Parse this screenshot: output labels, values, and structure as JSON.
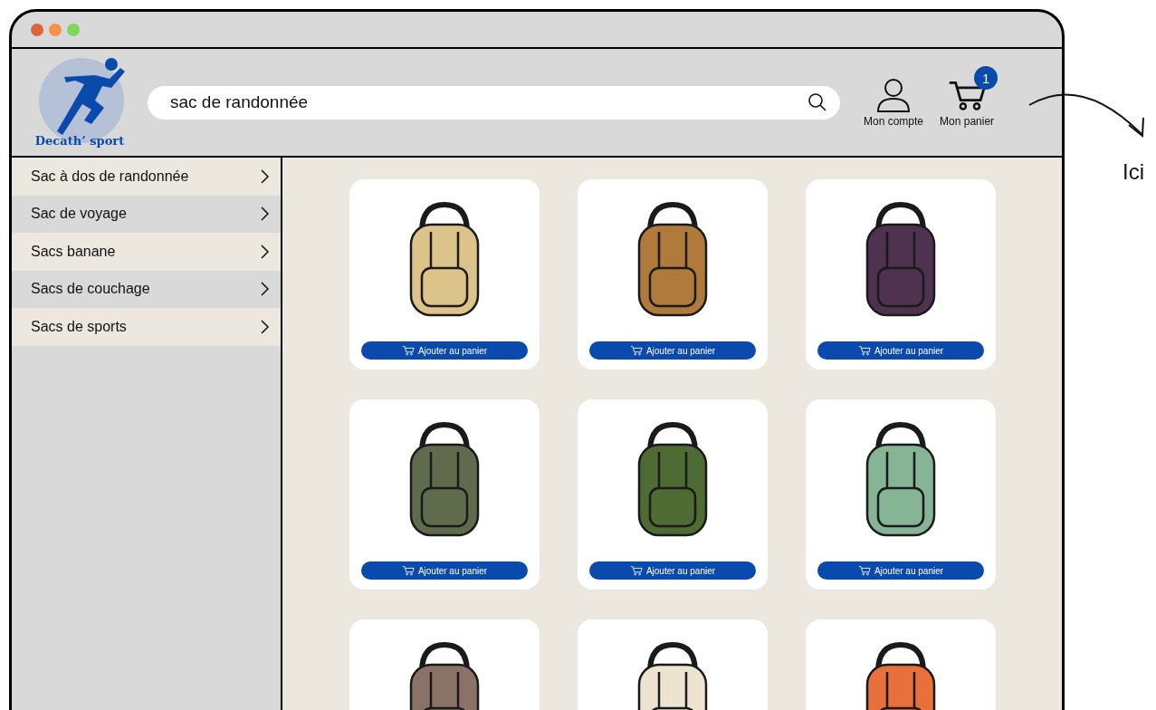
{
  "window": {
    "controls": [
      {
        "color": "#e0643a"
      },
      {
        "color": "#f9914a"
      },
      {
        "color": "#7ed957"
      }
    ]
  },
  "header": {
    "logo_text": "Decath’ sport",
    "search": {
      "value": "sac de randonnée"
    },
    "account": {
      "label": "Mon compte"
    },
    "cart": {
      "label": "Mon panier",
      "count": "1"
    }
  },
  "sidebar": {
    "items": [
      {
        "label": "Sac à dos de randonnée"
      },
      {
        "label": "Sac de voyage"
      },
      {
        "label": "Sacs banane"
      },
      {
        "label": "Sacs de couchage"
      },
      {
        "label": "Sacs de sports"
      }
    ]
  },
  "products": [
    {
      "color": "#dcc38a",
      "button": "Ajouter au panier"
    },
    {
      "color": "#b07a3a",
      "button": "Ajouter au panier"
    },
    {
      "color": "#4f3250",
      "button": "Ajouter au panier"
    },
    {
      "color": "#5f6b4c",
      "button": "Ajouter au panier"
    },
    {
      "color": "#4d6b33",
      "button": "Ajouter au panier"
    },
    {
      "color": "#86b596",
      "button": "Ajouter au panier"
    },
    {
      "color": "#8a7366"
    },
    {
      "color": "#ece3d0"
    },
    {
      "color": "#e8703a"
    }
  ],
  "annotation": {
    "text": "Ici"
  }
}
